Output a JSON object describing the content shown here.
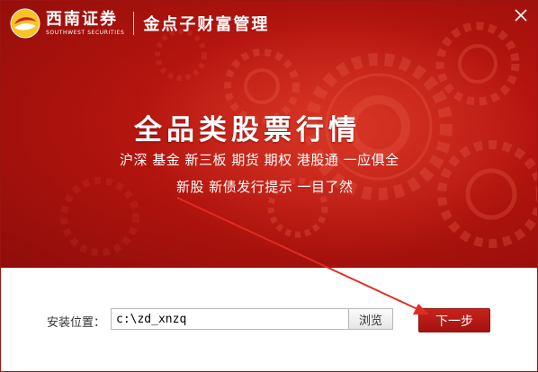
{
  "window": {
    "brand_cn": "西南证券",
    "brand_en": "SOUTHWEST SECURITIES",
    "product_name": "金点子财富管理"
  },
  "banner": {
    "headline": "全品类股票行情",
    "features_line1": "沪深 基金 新三板 期货 期权 港股通 一应俱全",
    "features_line2": "新股 新债发行提示 一目了然"
  },
  "install": {
    "label": "安装位置：",
    "path_value": "c:\\zd_xnzq",
    "browse_label": "浏览",
    "next_label": "下一步"
  },
  "colors": {
    "banner_red": "#b3140e",
    "accent_red": "#c8231b",
    "arrow_red": "#e02c22"
  },
  "icons": [
    "southwest-securities-logo-icon",
    "close-icon",
    "gear-pattern",
    "pointer-arrow"
  ]
}
